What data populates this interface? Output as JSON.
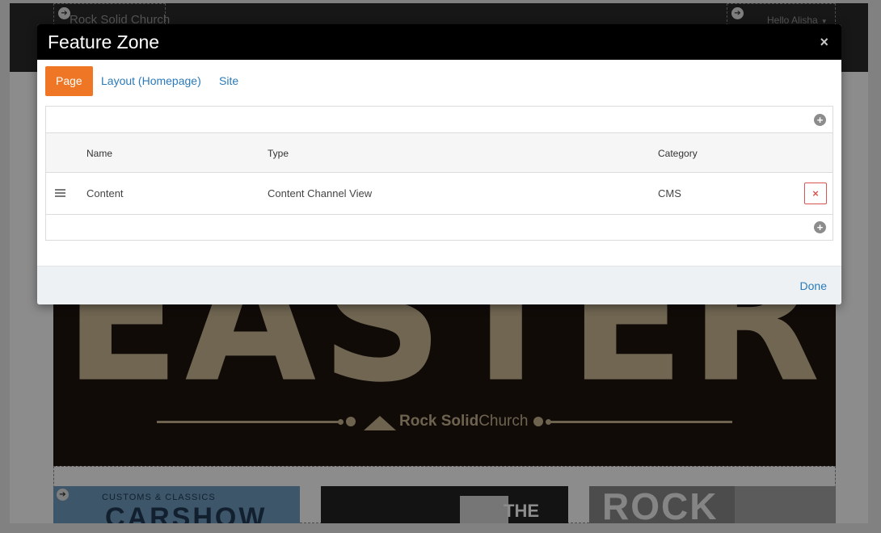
{
  "background_page": {
    "site_name": "Rock Solid Church",
    "greeting": "Hello Alisha",
    "hero": {
      "word": "EASTER",
      "brand_bold": "Rock Solid",
      "brand_light": "Church"
    },
    "thumbnails": [
      {
        "banner": "CUSTOMS & CLASSICS",
        "title": "CARSHOW"
      },
      {
        "banner": "",
        "title": "THE"
      },
      {
        "banner": "",
        "title": "ROCK"
      }
    ]
  },
  "modal": {
    "title": "Feature Zone",
    "close_label": "×",
    "tabs": [
      {
        "label": "Page",
        "active": true
      },
      {
        "label": "Layout (Homepage)",
        "active": false
      },
      {
        "label": "Site",
        "active": false
      }
    ],
    "grid": {
      "columns": {
        "name": "Name",
        "type": "Type",
        "category": "Category"
      },
      "rows": [
        {
          "name": "Content",
          "type": "Content Channel View",
          "category": "CMS",
          "delete_label": "×"
        }
      ],
      "add_label": "+"
    },
    "footer": {
      "done_label": "Done"
    }
  },
  "colors": {
    "modal_header": "#000000",
    "active_tab": "#ee7624",
    "link": "#2a7ab8",
    "delete": "#d9534f",
    "footer": "#eef1f4"
  },
  "icons": [
    "zone-arrow-icon",
    "caret-down-icon",
    "close-icon",
    "add-circle-icon",
    "drag-handle-icon",
    "delete-x-icon"
  ]
}
